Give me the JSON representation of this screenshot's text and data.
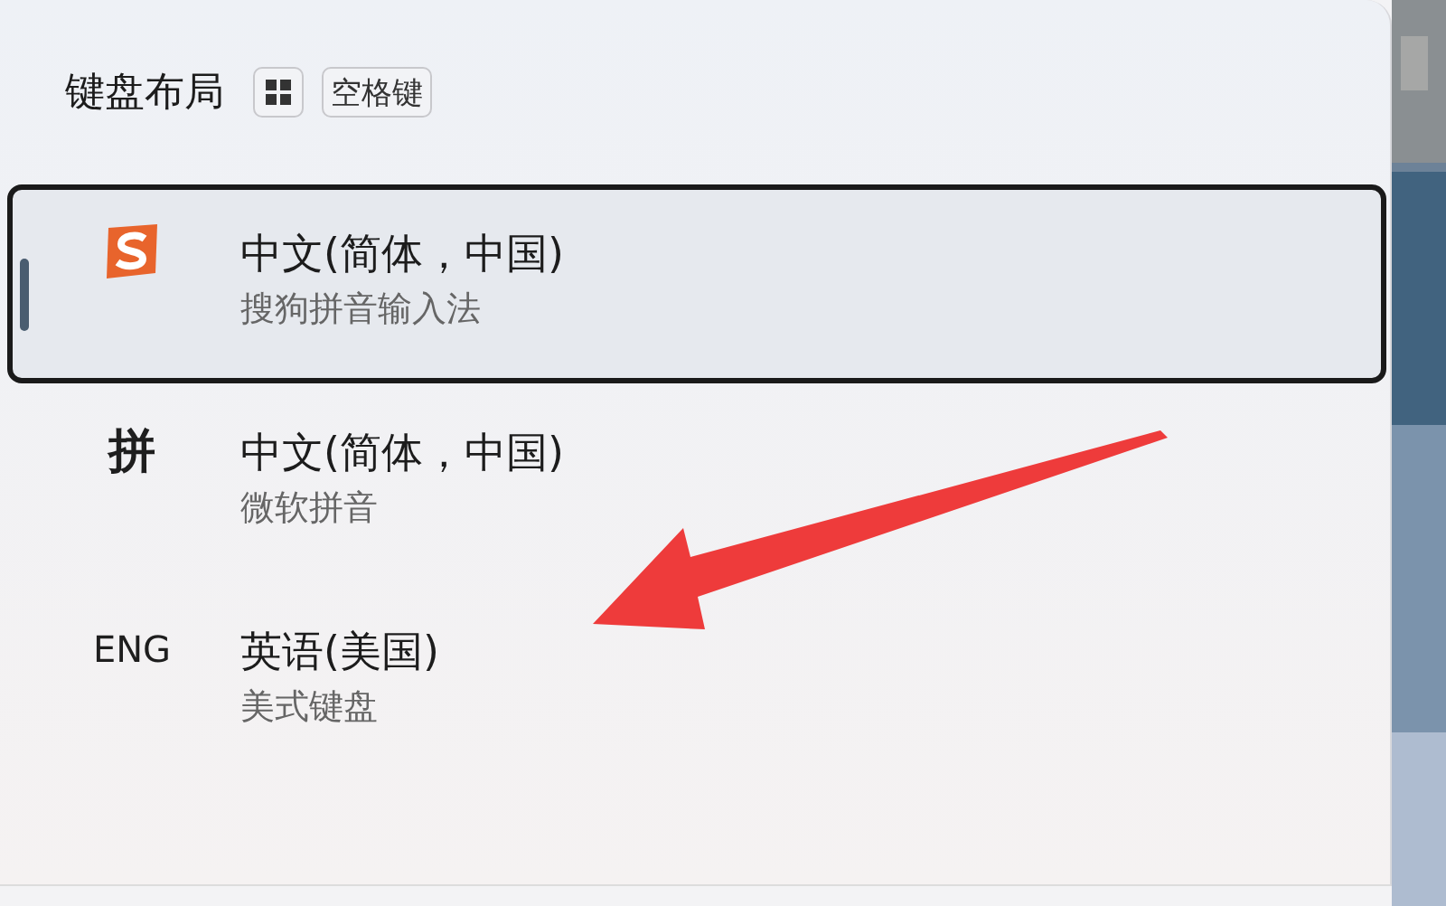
{
  "header": {
    "title": "键盘布局",
    "keys": [
      {
        "kind": "windows"
      },
      {
        "kind": "text",
        "label": "空格键"
      }
    ]
  },
  "items": [
    {
      "kind": "logo",
      "name": "中文(简体，中国)",
      "method": "搜狗拼音输入法",
      "selected": true
    },
    {
      "kind": "glyph",
      "glyph": "拼",
      "name": "中文(简体，中国)",
      "method": "微软拼音",
      "selected": false
    },
    {
      "kind": "label",
      "glyph": "ENG",
      "name": "英语(美国)",
      "method": "美式键盘",
      "selected": false
    }
  ]
}
